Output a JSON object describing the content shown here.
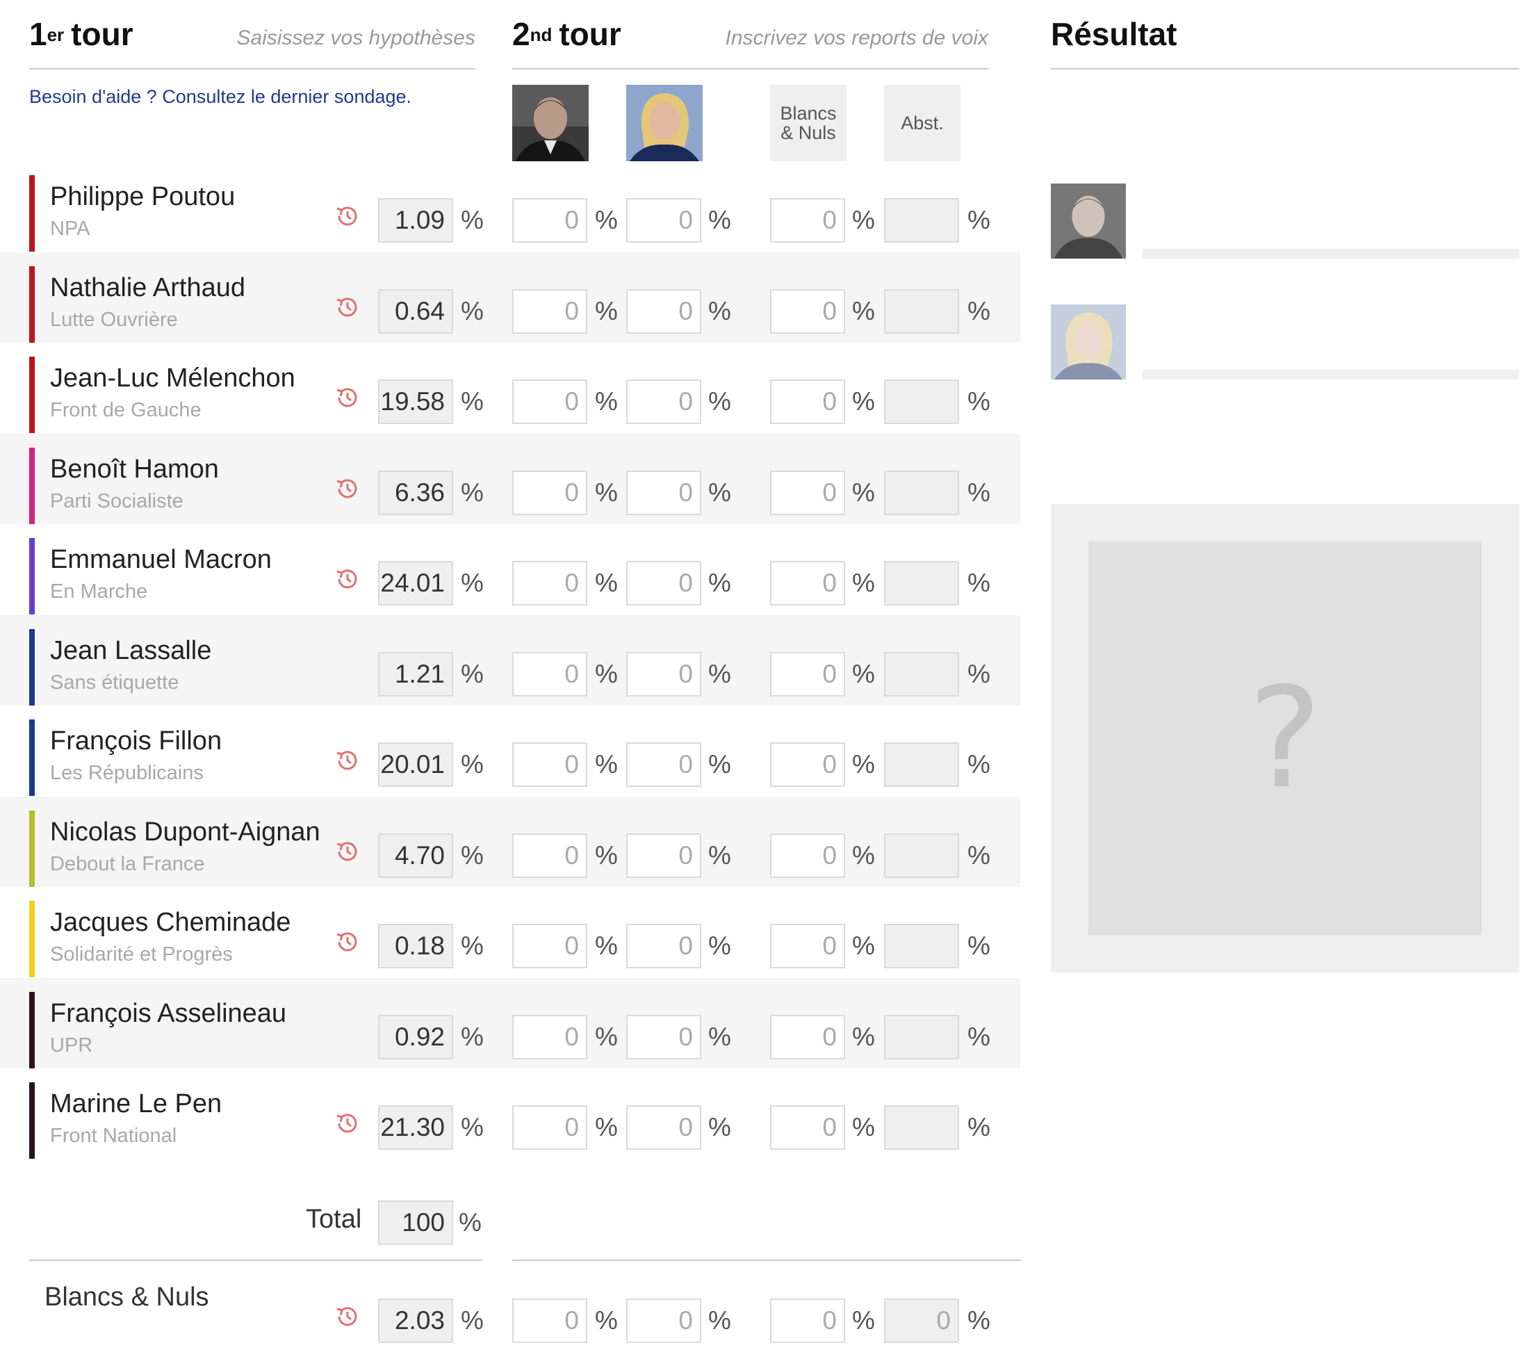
{
  "round1": {
    "title_num": "1",
    "title_sup": "er",
    "title_word": "tour",
    "hint": "Saisissez vos hypothèses",
    "help_link": "Besoin d'aide ? Consultez le dernier sondage."
  },
  "round2": {
    "title_num": "2",
    "title_sup": "nd",
    "title_word": "tour",
    "hint": "Inscrivez vos reports de voix",
    "col_blancs": "Blancs\n& Nuls",
    "col_abst": "Abst."
  },
  "result": {
    "title": "Résultat",
    "placeholder": "?"
  },
  "percent_sign": "%",
  "colors": {
    "link": "#1f3c8c",
    "history_icon": "#e07070"
  },
  "candidates": [
    {
      "name": "Philippe Poutou",
      "party": "NPA",
      "round1": "1.09",
      "macron": "0",
      "lepen": "0",
      "blancs": "0",
      "abst": "",
      "color": "#c0121a",
      "history": true
    },
    {
      "name": "Nathalie Arthaud",
      "party": "Lutte Ouvrière",
      "round1": "0.64",
      "macron": "0",
      "lepen": "0",
      "blancs": "0",
      "abst": "",
      "color": "#c0121a",
      "history": true
    },
    {
      "name": "Jean-Luc Mélenchon",
      "party": "Front de Gauche",
      "round1": "19.58",
      "macron": "0",
      "lepen": "0",
      "blancs": "0",
      "abst": "",
      "color": "#c0121a",
      "history": true
    },
    {
      "name": "Benoît Hamon",
      "party": "Parti Socialiste",
      "round1": "6.36",
      "macron": "0",
      "lepen": "0",
      "blancs": "0",
      "abst": "",
      "color": "#d4237a",
      "history": true
    },
    {
      "name": "Emmanuel Macron",
      "party": "En Marche",
      "round1": "24.01",
      "macron": "0",
      "lepen": "0",
      "blancs": "0",
      "abst": "",
      "color": "#6a3fc8",
      "history": true
    },
    {
      "name": "Jean Lassalle",
      "party": "Sans étiquette",
      "round1": "1.21",
      "macron": "0",
      "lepen": "0",
      "blancs": "0",
      "abst": "",
      "color": "#1a3a8c",
      "history": false
    },
    {
      "name": "François Fillon",
      "party": "Les Républicains",
      "round1": "20.01",
      "macron": "0",
      "lepen": "0",
      "blancs": "0",
      "abst": "",
      "color": "#1a3a8c",
      "history": true
    },
    {
      "name": "Nicolas Dupont-Aignan",
      "party": "Debout la France",
      "round1": "4.70",
      "macron": "0",
      "lepen": "0",
      "blancs": "0",
      "abst": "",
      "color": "#b5c22a",
      "history": true
    },
    {
      "name": "Jacques Cheminade",
      "party": "Solidarité et Progrès",
      "round1": "0.18",
      "macron": "0",
      "lepen": "0",
      "blancs": "0",
      "abst": "",
      "color": "#f2d11a",
      "history": true
    },
    {
      "name": "François Asselineau",
      "party": "UPR",
      "round1": "0.92",
      "macron": "0",
      "lepen": "0",
      "blancs": "0",
      "abst": "",
      "color": "#2a1320",
      "history": false
    },
    {
      "name": "Marine Le Pen",
      "party": "Front National",
      "round1": "21.30",
      "macron": "0",
      "lepen": "0",
      "blancs": "0",
      "abst": "",
      "color": "#2a1320",
      "history": true
    }
  ],
  "total": {
    "label": "Total",
    "value": "100"
  },
  "blancs_nuls": {
    "label": "Blancs & Nuls",
    "round1": "2.03",
    "macron": "0",
    "lepen": "0",
    "blancs": "0",
    "abst": "0"
  }
}
